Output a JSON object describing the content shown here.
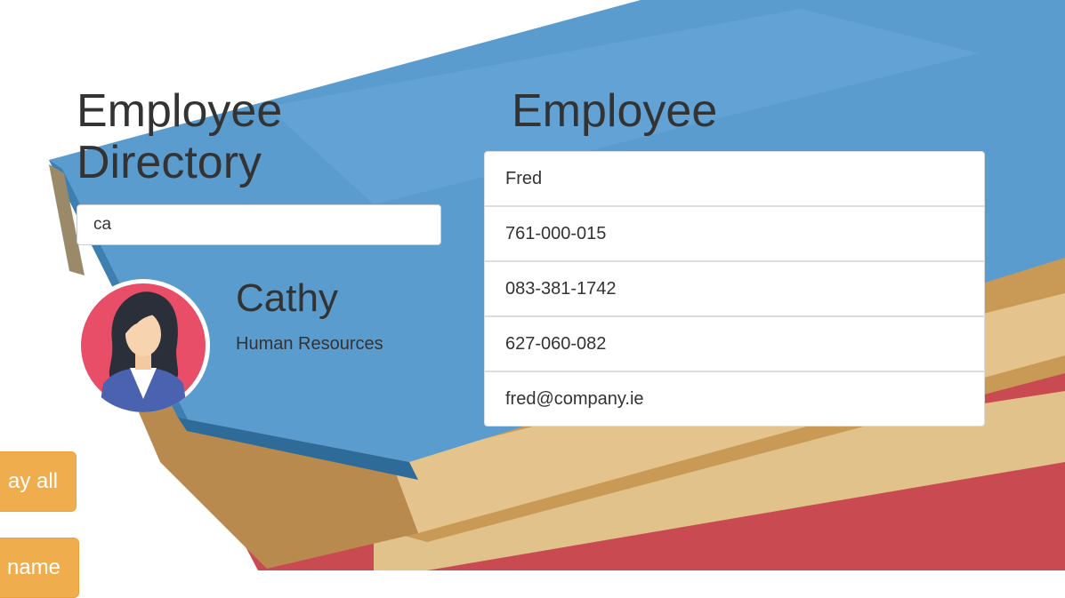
{
  "directory": {
    "title": "Employee Directory",
    "search": {
      "value": "ca",
      "placeholder": ""
    }
  },
  "result": {
    "name": "Cathy",
    "department": "Human Resources",
    "avatar_icon": "woman-avatar-icon"
  },
  "detail": {
    "title": "Employee",
    "items": [
      "Fred",
      "761-000-015",
      "083-381-1742",
      "627-060-082",
      "fred@company.ie"
    ]
  },
  "buttons": {
    "display_all": "ay all",
    "by_name": "name"
  },
  "colors": {
    "button": "#f0ad4e",
    "book_blue": "#5a9bd0",
    "book_red": "#cf5055",
    "avatar_bg": "#e94e68"
  }
}
